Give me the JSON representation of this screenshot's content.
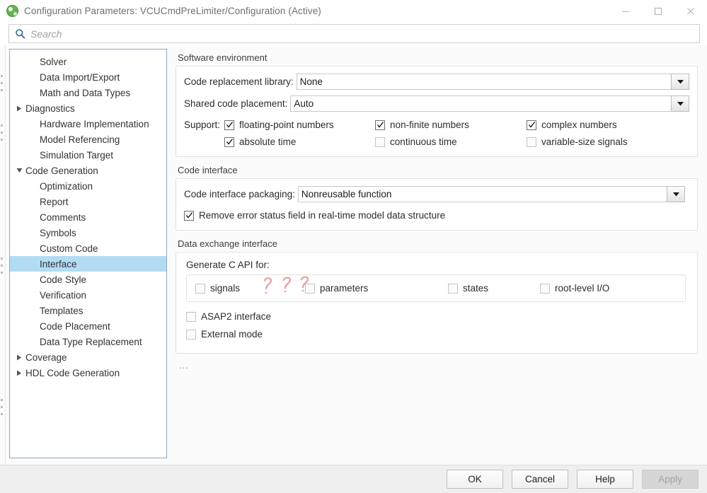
{
  "window": {
    "title": "Configuration Parameters: VCUCmdPreLimiter/Configuration (Active)",
    "icon": "simulink-icon",
    "minimize_label": "minimize-icon",
    "maximize_label": "maximize-icon",
    "close_label": "close-icon"
  },
  "search": {
    "placeholder": "Search",
    "value": "",
    "icon": "search-icon"
  },
  "tree": {
    "items": [
      {
        "label": "Solver",
        "level": 0,
        "arrow": "none",
        "selected": false
      },
      {
        "label": "Data Import/Export",
        "level": 0,
        "arrow": "none",
        "selected": false
      },
      {
        "label": "Math and Data Types",
        "level": 0,
        "arrow": "none",
        "selected": false
      },
      {
        "label": "Diagnostics",
        "level": 0,
        "arrow": "collapsed",
        "selected": false
      },
      {
        "label": "Hardware Implementation",
        "level": 0,
        "arrow": "none",
        "selected": false
      },
      {
        "label": "Model Referencing",
        "level": 0,
        "arrow": "none",
        "selected": false
      },
      {
        "label": "Simulation Target",
        "level": 0,
        "arrow": "none",
        "selected": false
      },
      {
        "label": "Code Generation",
        "level": 0,
        "arrow": "expanded",
        "selected": false
      },
      {
        "label": "Optimization",
        "level": 1,
        "arrow": "none",
        "selected": false
      },
      {
        "label": "Report",
        "level": 1,
        "arrow": "none",
        "selected": false
      },
      {
        "label": "Comments",
        "level": 1,
        "arrow": "none",
        "selected": false
      },
      {
        "label": "Symbols",
        "level": 1,
        "arrow": "none",
        "selected": false
      },
      {
        "label": "Custom Code",
        "level": 1,
        "arrow": "none",
        "selected": false
      },
      {
        "label": "Interface",
        "level": 1,
        "arrow": "none",
        "selected": true
      },
      {
        "label": "Code Style",
        "level": 1,
        "arrow": "none",
        "selected": false
      },
      {
        "label": "Verification",
        "level": 1,
        "arrow": "none",
        "selected": false
      },
      {
        "label": "Templates",
        "level": 1,
        "arrow": "none",
        "selected": false
      },
      {
        "label": "Code Placement",
        "level": 1,
        "arrow": "none",
        "selected": false
      },
      {
        "label": "Data Type Replacement",
        "level": 1,
        "arrow": "none",
        "selected": false
      },
      {
        "label": "Coverage",
        "level": 0,
        "arrow": "collapsed",
        "selected": false
      },
      {
        "label": "HDL Code Generation",
        "level": 0,
        "arrow": "collapsed",
        "selected": false
      }
    ]
  },
  "software_environment": {
    "title": "Software environment",
    "code_replacement_library": {
      "label": "Code replacement library:",
      "value": "None"
    },
    "shared_code_placement": {
      "label": "Shared code placement:",
      "value": "Auto"
    },
    "support_label": "Support:",
    "support_options": [
      {
        "label": "floating-point numbers",
        "checked": true
      },
      {
        "label": "non-finite numbers",
        "checked": true
      },
      {
        "label": "complex numbers",
        "checked": true
      },
      {
        "label": "absolute time",
        "checked": true
      },
      {
        "label": "continuous time",
        "checked": false
      },
      {
        "label": "variable-size signals",
        "checked": false
      }
    ]
  },
  "code_interface": {
    "title": "Code interface",
    "packaging": {
      "label": "Code interface packaging:",
      "value": "Nonreusable function"
    },
    "remove_error_status": {
      "label": "Remove error status field in real-time model data structure",
      "checked": true
    }
  },
  "data_exchange_interface": {
    "title": "Data exchange interface",
    "generate_c_api_label": "Generate C API for:",
    "c_api_options": [
      {
        "label": "signals",
        "checked": false
      },
      {
        "label": "parameters",
        "checked": false
      },
      {
        "label": "states",
        "checked": false
      },
      {
        "label": "root-level I/O",
        "checked": false
      }
    ],
    "asap2": {
      "label": "ASAP2 interface",
      "checked": false
    },
    "external_mode": {
      "label": "External mode",
      "checked": false
    }
  },
  "overflow_indicator": "...",
  "annotation": {
    "text": "???",
    "color": "#e59a9a"
  },
  "footer": {
    "buttons": [
      {
        "label": "OK",
        "disabled": false
      },
      {
        "label": "Cancel",
        "disabled": false
      },
      {
        "label": "Help",
        "disabled": false
      },
      {
        "label": "Apply",
        "disabled": true
      }
    ]
  }
}
